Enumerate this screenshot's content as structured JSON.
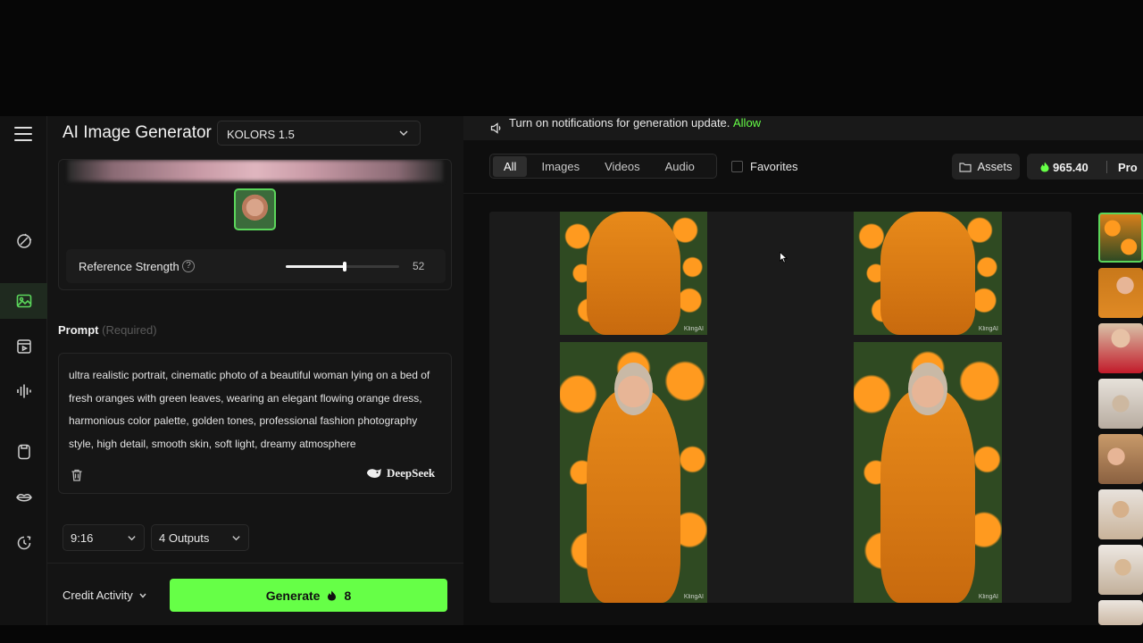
{
  "app": {
    "title": "AI Image Generator",
    "model": "KOLORS 1.5"
  },
  "rail": {
    "items": [
      {
        "icon": "magic-wand-icon",
        "active": false
      },
      {
        "icon": "image-icon",
        "active": true
      },
      {
        "icon": "video-icon",
        "active": false
      },
      {
        "icon": "audio-wave-icon",
        "active": false
      },
      {
        "icon": "clothing-icon",
        "active": false
      },
      {
        "icon": "lips-icon",
        "active": false
      },
      {
        "icon": "history-icon",
        "active": false
      }
    ]
  },
  "reference": {
    "strength_label": "Reference Strength",
    "strength_value": "52",
    "strength_fraction": 0.52
  },
  "prompt": {
    "title": "Prompt",
    "required": "(Required)",
    "text": "ultra realistic portrait, cinematic photo of a beautiful woman lying on a bed of fresh oranges with green leaves, wearing an elegant flowing orange dress, harmonious color palette, golden tones, professional fashion photography style, high detail, smooth skin, soft light, dreamy atmosphere",
    "assistant": "DeepSeek"
  },
  "options": {
    "aspect": "9:16",
    "outputs": "4 Outputs"
  },
  "footer": {
    "credit_activity": "Credit Activity",
    "generate_label": "Generate",
    "generate_cost": "8"
  },
  "notification": {
    "message": "Turn on notifications for generation update.",
    "action": "Allow"
  },
  "filters": {
    "tabs": [
      "All",
      "Images",
      "Videos",
      "Audio"
    ],
    "active_tab": "All",
    "favorites": "Favorites"
  },
  "account": {
    "assets": "Assets",
    "credits": "965.40",
    "plan": "Pro"
  },
  "gallery": {
    "watermark": "KlingAI"
  },
  "colors": {
    "accent": "#66ff47",
    "background": "#141414"
  }
}
